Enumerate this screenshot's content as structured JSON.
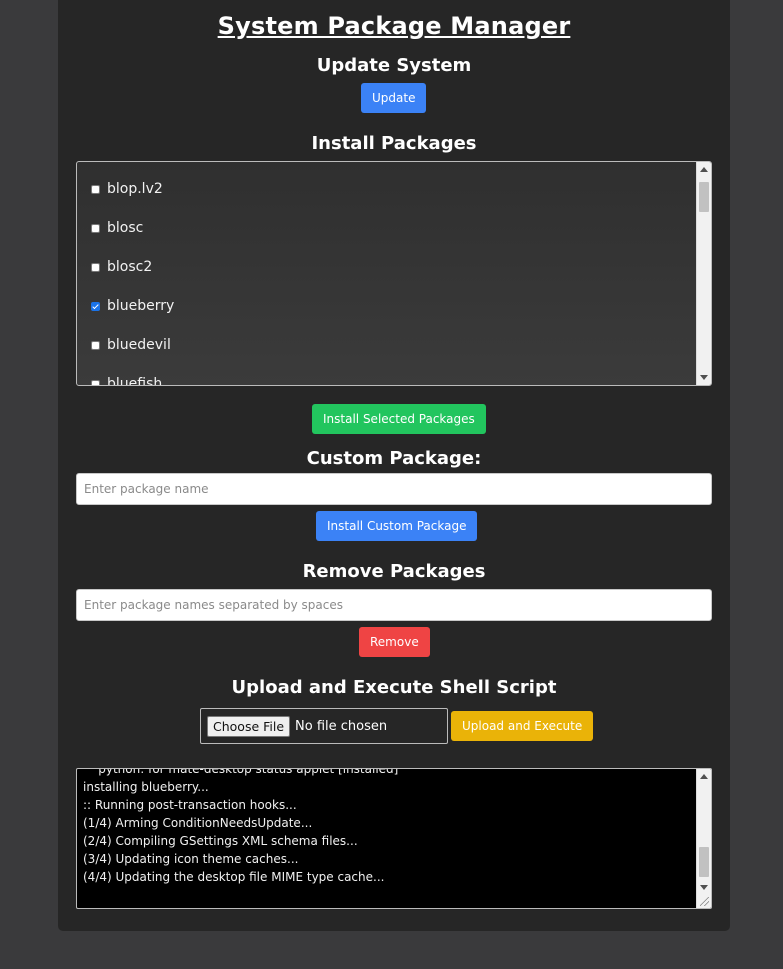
{
  "title": "System Package Manager",
  "update": {
    "heading": "Update System",
    "button": "Update"
  },
  "install": {
    "heading": "Install Packages",
    "packages": [
      {
        "name": "blop.lv2",
        "checked": false
      },
      {
        "name": "blosc",
        "checked": false
      },
      {
        "name": "blosc2",
        "checked": false
      },
      {
        "name": "blueberry",
        "checked": true
      },
      {
        "name": "bluedevil",
        "checked": false
      },
      {
        "name": "bluefish",
        "checked": false
      }
    ],
    "button": "Install Selected Packages"
  },
  "custom": {
    "heading": "Custom Package:",
    "placeholder": "Enter package name",
    "button": "Install Custom Package"
  },
  "remove": {
    "heading": "Remove Packages",
    "placeholder": "Enter package names separated by spaces",
    "button": "Remove"
  },
  "upload": {
    "heading": "Upload and Execute Shell Script",
    "choose_label": "Choose File",
    "file_status": "No file chosen",
    "button": "Upload and Execute"
  },
  "output": {
    "lines": [
      "    python: for mate-desktop status applet [installed]",
      "installing blueberry...",
      ":: Running post-transaction hooks...",
      "(1/4) Arming ConditionNeedsUpdate...",
      "(2/4) Compiling GSettings XML schema files...",
      "(3/4) Updating icon theme caches...",
      "(4/4) Updating the desktop file MIME type cache..."
    ]
  },
  "colors": {
    "primary": "#3b82f6",
    "success": "#22c55e",
    "danger": "#ef4444",
    "warning": "#eab308",
    "panel": "#262626",
    "background": "#3a3a3c"
  }
}
